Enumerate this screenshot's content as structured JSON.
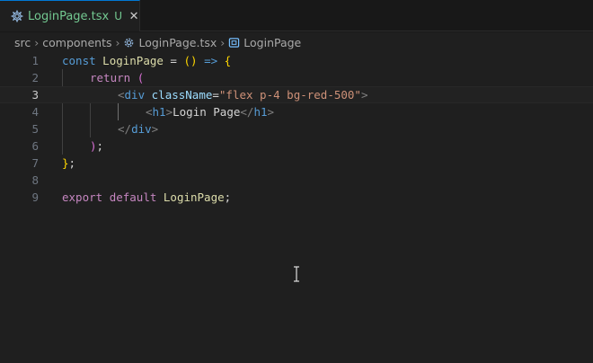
{
  "tab": {
    "filename": "LoginPage.tsx",
    "status": "U",
    "close_glyph": "✕",
    "icon": "react-gear-icon"
  },
  "breadcrumb": {
    "items": [
      "src",
      "components",
      "LoginPage.tsx",
      "LoginPage"
    ],
    "separator": "›"
  },
  "editor": {
    "active_line": 3,
    "line_numbers": [
      "1",
      "2",
      "3",
      "4",
      "5",
      "6",
      "7",
      "8",
      "9"
    ],
    "tokens": {
      "l1_const": "const",
      "l1_name": "LoginPage",
      "l1_eq": " = ",
      "l1_paren": "()",
      "l1_arrow": " => ",
      "l1_brace": "{",
      "l2_return": "return",
      "l2_paren": "(",
      "l3_lt": "<",
      "l3_tag": "div",
      "l3_attr": "className",
      "l3_eq": "=",
      "l3_str": "\"flex p-4 bg-red-500\"",
      "l3_gt": ">",
      "l4_open": "<",
      "l4_tag": "h1",
      "l4_gt": ">",
      "l4_text": "Login Page",
      "l4_close_lt": "</",
      "l4_close_tag": "h1",
      "l4_close_gt": ">",
      "l5_lt": "</",
      "l5_tag": "div",
      "l5_gt": ">",
      "l6_paren": ")",
      "l6_semi": ";",
      "l7_brace": "}",
      "l7_semi": ";",
      "l9_export": "export",
      "l9_default": "default",
      "l9_name": "LoginPage",
      "l9_semi": ";"
    }
  },
  "colors": {
    "background": "#1f1f1f",
    "tab_accent": "#0078d4",
    "untracked_file": "#73c991"
  }
}
